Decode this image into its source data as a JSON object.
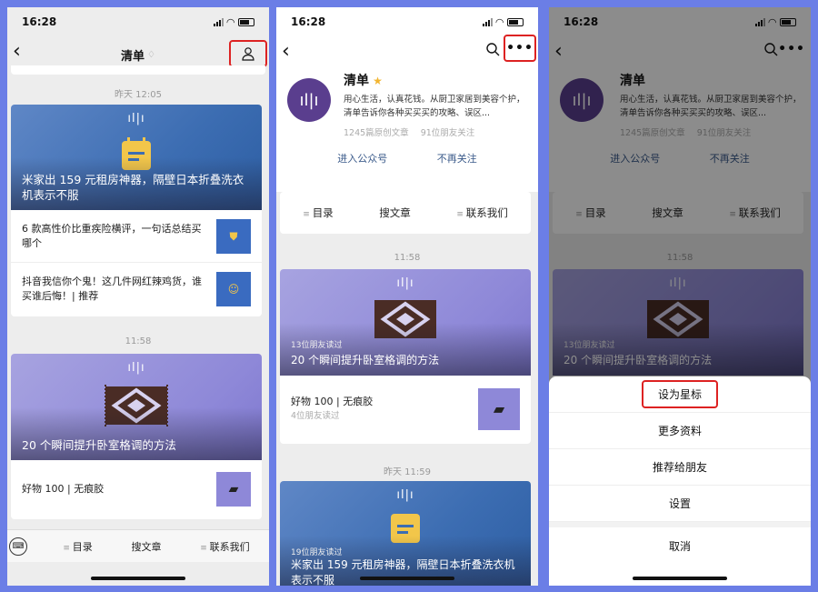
{
  "status_time": "16:28",
  "p1": {
    "nav_title": "清单",
    "time1": "昨天 12:05",
    "banner1_title": "米家出 159 元租房神器，隔壁日本折叠洗衣机表示不服",
    "item1": "6 款高性价比重疾险横评，一句话总结买哪个",
    "item2": "抖音我信你个鬼！这几件网红辣鸡货，谁买谁后悔！| 推荐",
    "time2": "11:58",
    "banner2_title": "20 个瞬间提升卧室格调的方法",
    "item3": "好物 100 | 无痕胶",
    "tabs": [
      "目录",
      "搜文章",
      "联系我们"
    ]
  },
  "profile": {
    "name": "清单",
    "desc": "用心生活，认真花钱。从厨卫家居到美容个护，清单告诉你各种买买买的攻略、误区...",
    "articles": "1245篇原创文章",
    "followers": "91位朋友关注",
    "enter": "进入公众号",
    "unfollow": "不再关注",
    "menu": [
      "目录",
      "搜文章",
      "联系我们"
    ],
    "time1": "11:58",
    "reads1": "13位朋友读过",
    "banner1_title": "20 个瞬间提升卧室格调的方法",
    "item1": "好物 100 | 无痕胶",
    "item1_reads": "4位朋友读过",
    "time2": "昨天 11:59",
    "reads2": "19位朋友读过",
    "banner2_title": "米家出 159 元租房神器，隔壁日本折叠洗衣机表示不服"
  },
  "sheet": {
    "items": [
      "设为星标",
      "更多资料",
      "推荐给朋友",
      "设置"
    ],
    "cancel": "取消"
  }
}
